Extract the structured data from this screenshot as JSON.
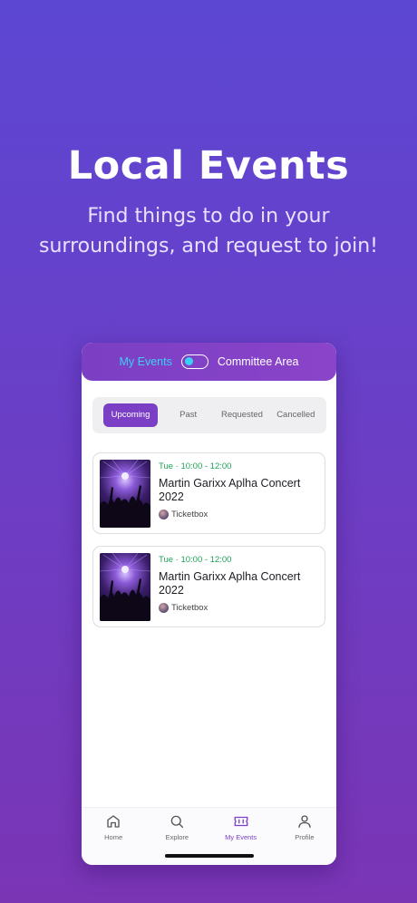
{
  "hero": {
    "title": "Local Events",
    "subtitle_line1": "Find things to do in your",
    "subtitle_line2": "surroundings, and request to join!"
  },
  "header": {
    "my_events_label": "My Events",
    "committee_label": "Committee Area",
    "toggle_on": false
  },
  "tabs": [
    {
      "label": "Upcoming",
      "active": true
    },
    {
      "label": "Past",
      "active": false
    },
    {
      "label": "Requested",
      "active": false
    },
    {
      "label": "Cancelled",
      "active": false
    }
  ],
  "events": [
    {
      "time": "Tue · 10:00 - 12:00",
      "title": "Martin Garixx Aplha Concert 2022",
      "organizer": "Ticketbox"
    },
    {
      "time": "Tue · 10:00 - 12:00",
      "title": "Martin Garixx Aplha Concert 2022",
      "organizer": "Ticketbox"
    }
  ],
  "bottom_nav": [
    {
      "label": "Home",
      "icon": "home-icon",
      "active": false
    },
    {
      "label": "Explore",
      "icon": "search-icon",
      "active": false
    },
    {
      "label": "My Events",
      "icon": "ticket-icon",
      "active": true
    },
    {
      "label": "Profile",
      "icon": "user-icon",
      "active": false
    }
  ],
  "colors": {
    "accent": "#7a3fc4",
    "toggle_accent": "#3ad1f5",
    "time_green": "#1fa25a",
    "background_top": "#5c47d3",
    "background_bottom": "#7a35b5"
  }
}
